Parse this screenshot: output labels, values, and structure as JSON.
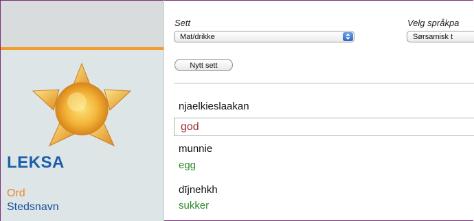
{
  "sidebar": {
    "brand": "LEKSA",
    "nav": [
      {
        "label": "Ord",
        "color": "#e8872a"
      },
      {
        "label": "Stedsnavn",
        "color": "#1a4e9a"
      }
    ]
  },
  "main": {
    "set_label": "Sett",
    "set_select_value": "Mat/drikke",
    "language_label": "Velg språkpa",
    "language_select_value": "Sørsamisk t",
    "new_set_button": "Nytt sett",
    "current_word": "njaelkieslaakan",
    "answer_input_value": "god",
    "items": [
      {
        "word": "munnie",
        "answer": "egg"
      },
      {
        "word": "dījnehkh",
        "answer": "sukker"
      }
    ]
  },
  "colors": {
    "accent_orange": "#f39c2a",
    "brand_blue": "#1a5ea8",
    "answer_green": "#2a8a2a",
    "input_text_red": "#9c2f2f"
  }
}
